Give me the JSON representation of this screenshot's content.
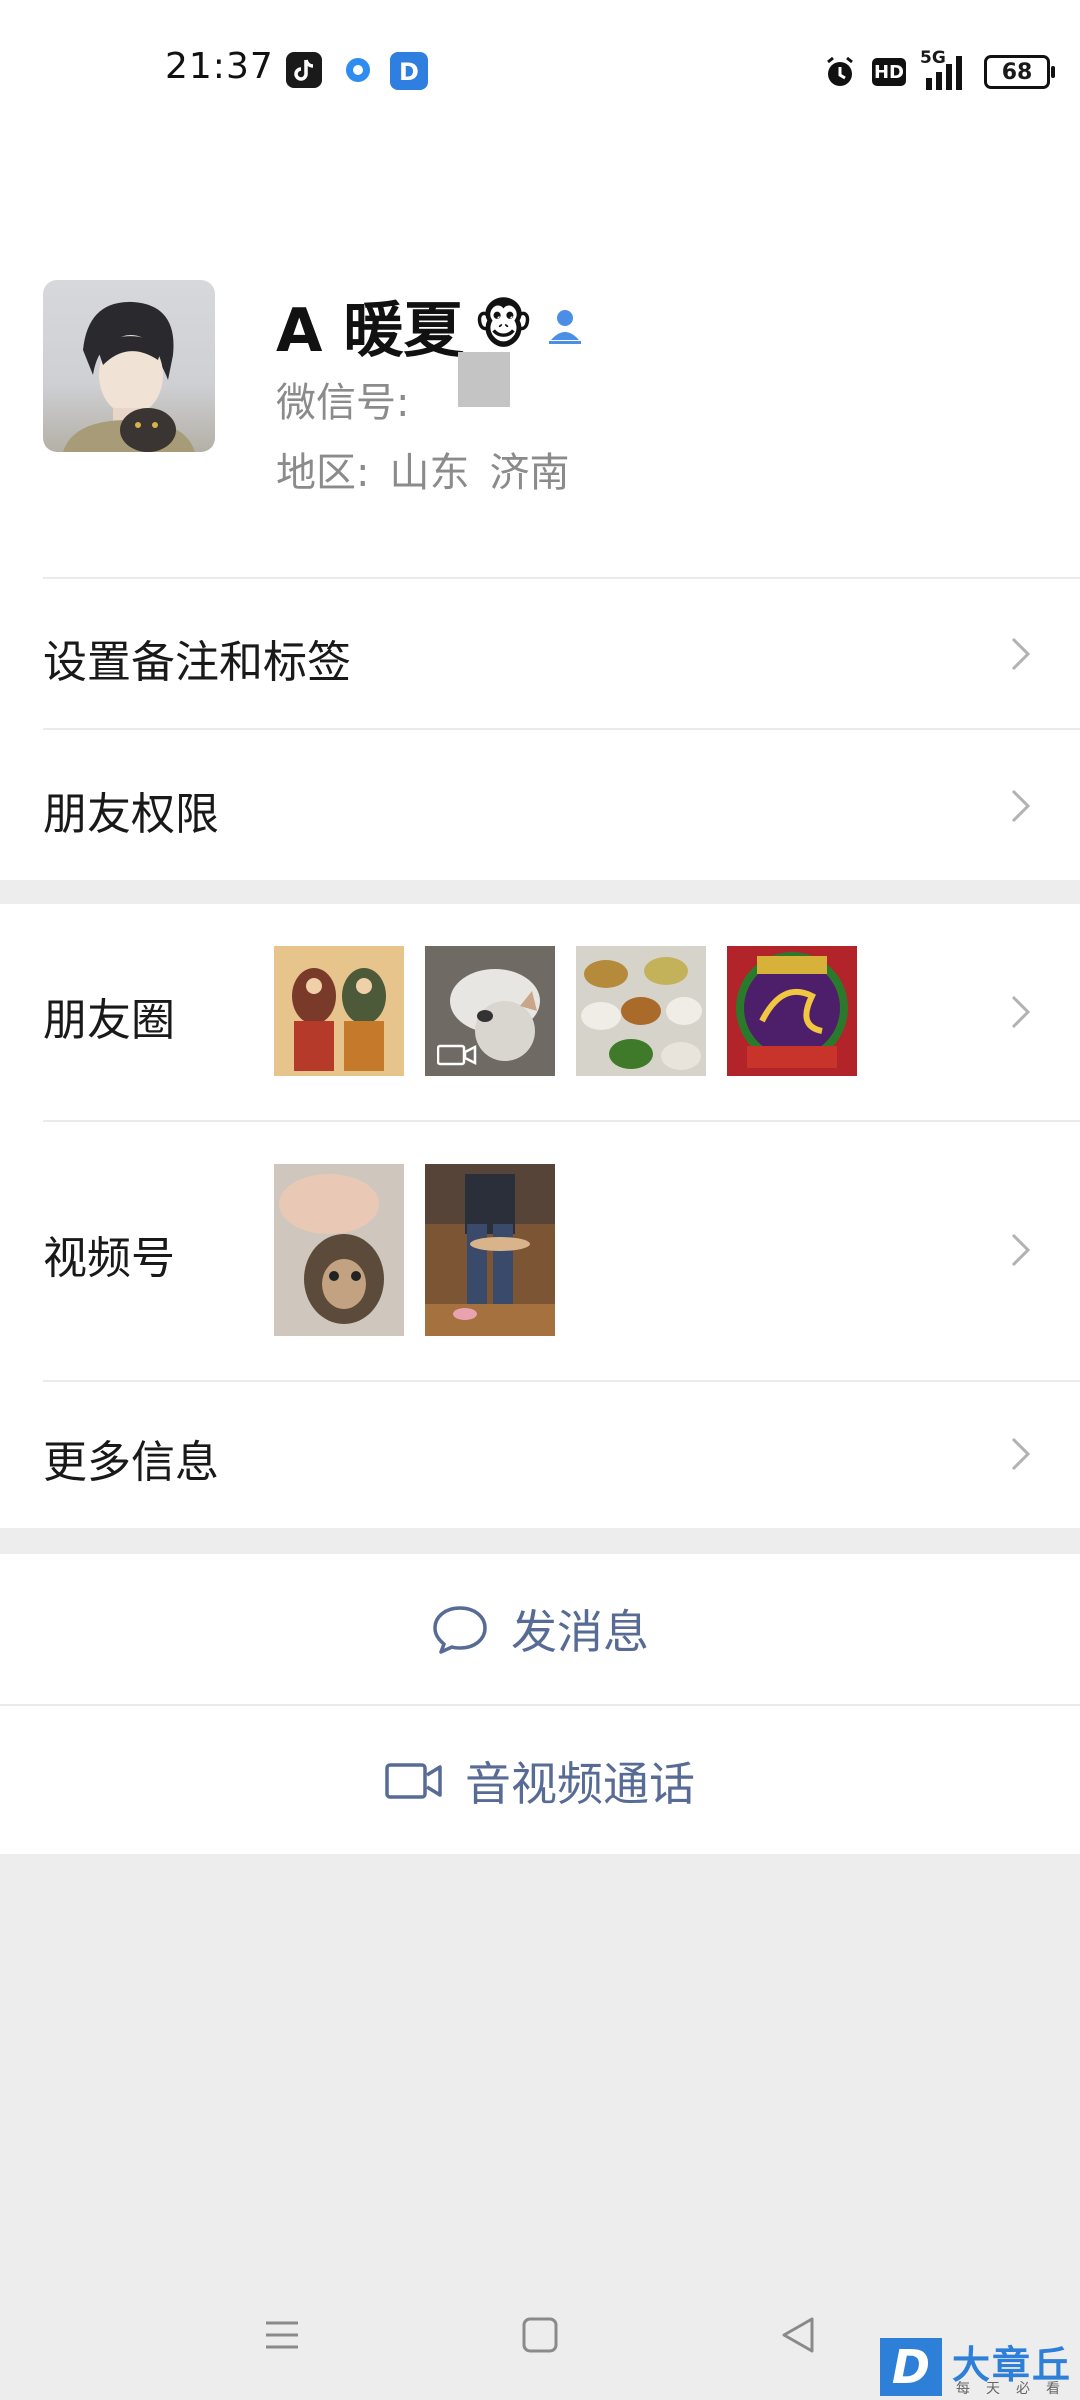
{
  "status_bar": {
    "time": "21:37",
    "network_label": "5G",
    "hd_label": "HD",
    "battery": "68",
    "icons": [
      "tiktok-icon",
      "browser-icon",
      "dazhangqiu-app-icon",
      "alarm-icon",
      "hd-icon",
      "signal-icon",
      "battery-icon"
    ]
  },
  "header": {
    "back_icon": "chevron-left-icon",
    "more_icon": "more-dots-icon"
  },
  "profile": {
    "name": "A 暖夏",
    "name_emoji": "🐵",
    "wechat_id_label": "微信号:",
    "region_label": "地区:",
    "region_province": "山东",
    "region_city": "济南"
  },
  "menu": {
    "remark_tags": "设置备注和标签",
    "friend_permissions": "朋友权限",
    "moments": "朋友圈",
    "channels": "视频号",
    "more_info": "更多信息"
  },
  "actions": {
    "send_message": "发消息",
    "av_call": "音视频通话"
  },
  "watermark": {
    "logo_letter": "D",
    "brand": "大章丘",
    "slogan": "每天必看"
  },
  "colors": {
    "link_blue": "#576b95",
    "background": "#ededed",
    "brand_blue": "#2d7fd8"
  }
}
